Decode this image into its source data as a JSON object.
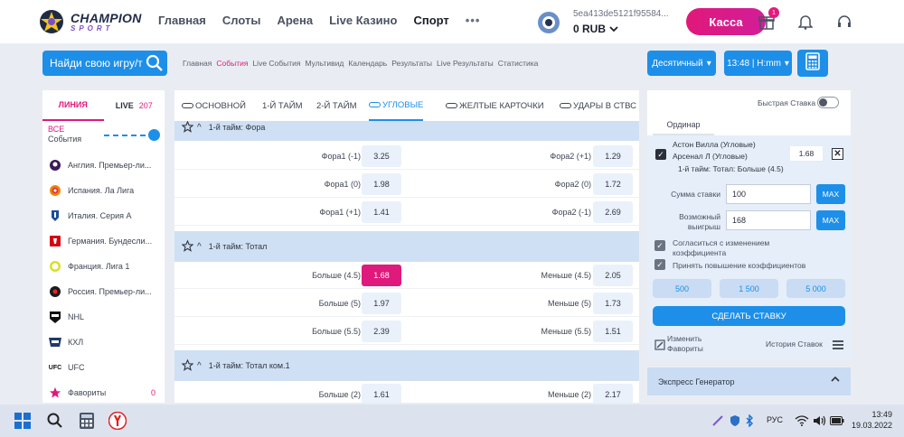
{
  "header": {
    "logo_main": "CHAMPION",
    "logo_sub": "SPORT",
    "nav": [
      "Главная",
      "Слоты",
      "Арена",
      "Live Казино",
      "Спорт"
    ],
    "nav_more": "•••",
    "account_id": "5ea413de5121f95584...",
    "balance": "0 RUB",
    "kassa_label": "Касса",
    "gift_badge": "1"
  },
  "subheader": {
    "search_placeholder": "Найди свою игру/т",
    "links": [
      "Главная",
      "События",
      "Live События",
      "Мультивид",
      "Календарь",
      "Результаты",
      "Live Результаты",
      "Статистика"
    ],
    "active_link": "События",
    "odds_format": "Десятичный",
    "time_format": "13:48 | Н:mm"
  },
  "sidebar": {
    "tab_line": "ЛИНИЯ",
    "tab_live": "LIVE",
    "live_count": "207",
    "all_label_1": "ВСЕ",
    "all_label_2": "События",
    "items": [
      {
        "label": "Англия. Премьер-ли...",
        "icon": "premier-league-icon"
      },
      {
        "label": "Испания. Ла Лига",
        "icon": "laliga-icon"
      },
      {
        "label": "Италия. Серия А",
        "icon": "serie-a-icon"
      },
      {
        "label": "Германия. Бундесли...",
        "icon": "bundesliga-icon"
      },
      {
        "label": "Франция. Лига 1",
        "icon": "ligue1-icon"
      },
      {
        "label": "Россия. Премьер-ли...",
        "icon": "rpl-icon"
      },
      {
        "label": "NHL",
        "icon": "nhl-icon"
      },
      {
        "label": "КХЛ",
        "icon": "khl-icon"
      },
      {
        "label": "UFC",
        "icon": "ufc-icon"
      },
      {
        "label": "Фавориты",
        "icon": "star-icon",
        "count": "0"
      }
    ]
  },
  "market_tabs": [
    "ОСНОВНОЙ",
    "1-Й ТАЙМ",
    "2-Й ТАЙМ",
    "УГЛОВЫЕ",
    "ЖЕЛТЫЕ КАРТОЧКИ",
    "УДАРЫ В СТВС"
  ],
  "active_market_tab": "УГЛОВЫЕ",
  "markets": [
    {
      "title": "1-й тайм: Фора",
      "rows": [
        {
          "l_label": "Фора1 (-1)",
          "l_odd": "3.25",
          "r_label": "Фора2 (+1)",
          "r_odd": "1.29"
        },
        {
          "l_label": "Фора1 (0)",
          "l_odd": "1.98",
          "r_label": "Фора2 (0)",
          "r_odd": "1.72"
        },
        {
          "l_label": "Фора1 (+1)",
          "l_odd": "1.41",
          "r_label": "Фора2 (-1)",
          "r_odd": "2.69"
        }
      ]
    },
    {
      "title": "1-й тайм: Тотал",
      "rows": [
        {
          "l_label": "Больше (4.5)",
          "l_odd": "1.68",
          "r_label": "Меньше (4.5)",
          "r_odd": "2.05",
          "selected": "left"
        },
        {
          "l_label": "Больше (5)",
          "l_odd": "1.97",
          "r_label": "Меньше (5)",
          "r_odd": "1.73"
        },
        {
          "l_label": "Больше (5.5)",
          "l_odd": "2.39",
          "r_label": "Меньше (5.5)",
          "r_odd": "1.51"
        }
      ]
    },
    {
      "title": "1-й тайм: Тотал ком.1",
      "rows": [
        {
          "l_label": "Больше (2)",
          "l_odd": "1.61",
          "r_label": "Меньше (2)",
          "r_odd": "2.17"
        }
      ]
    }
  ],
  "betslip": {
    "quick_bet": "Быстрая Ставка",
    "tab": "Ординар",
    "team1": "Астон Вилла (Угловые)",
    "team2": "Арсенал Л (Угловые)",
    "market": "1-й тайм: Тотал: Больше (4.5)",
    "coef": "1.68",
    "amount_label": "Сумма ставки",
    "amount_value": "100",
    "win_label_1": "Возможный",
    "win_label_2": "выигрыш",
    "win_value": "168",
    "max_label": "MAX",
    "agree_1": "Согласиться с изменением",
    "agree_2": "коэффициента",
    "accept_increase": "Принять повышение коэффициентов",
    "quick_amounts": [
      "500",
      "1 500",
      "5 000"
    ],
    "make_bet": "СДЕЛАТЬ СТАВКУ",
    "edit_fav_1": "Изменить",
    "edit_fav_2": "Фавориты",
    "history": "История Ставок",
    "express": "Экспресс Генератор"
  },
  "taskbar": {
    "lang": "РУС",
    "time": "13:49",
    "date": "19.03.2022"
  },
  "colors": {
    "accent_blue": "#1d8fe8",
    "accent_pink": "#e0197d"
  }
}
